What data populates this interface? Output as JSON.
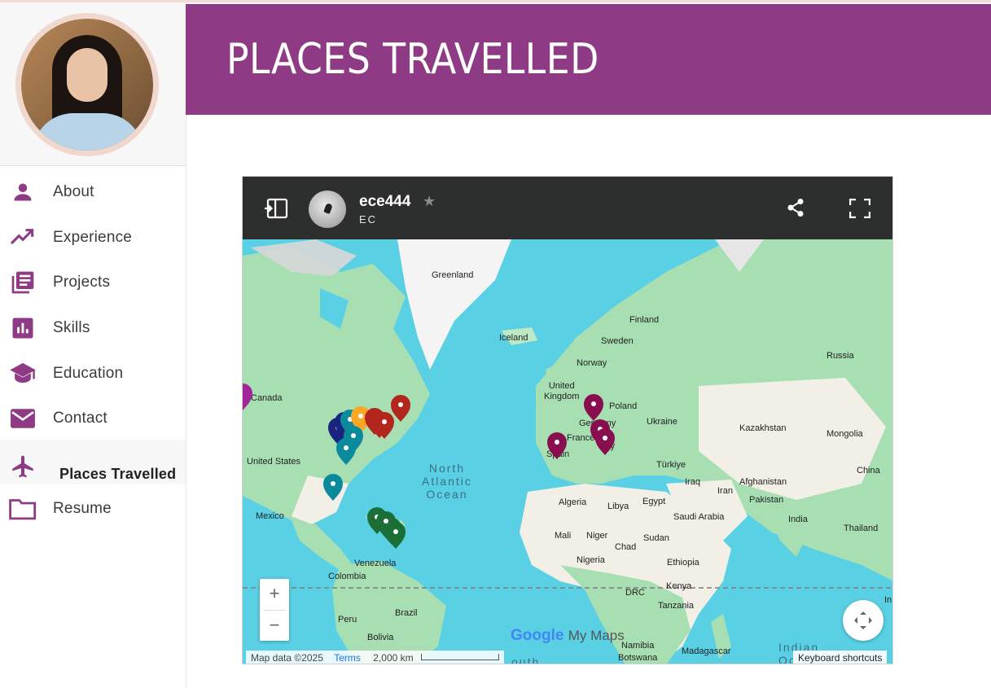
{
  "header": {
    "title": "PLACES TRAVELLED"
  },
  "sidebar": {
    "items": [
      {
        "label": "About",
        "icon": "person-icon"
      },
      {
        "label": "Experience",
        "icon": "trending-up-icon"
      },
      {
        "label": "Projects",
        "icon": "library-books-icon"
      },
      {
        "label": "Skills",
        "icon": "bar-chart-icon"
      },
      {
        "label": "Education",
        "icon": "graduation-cap-icon"
      },
      {
        "label": "Contact",
        "icon": "mail-icon"
      },
      {
        "label": "Places Travelled",
        "icon": "airplane-icon",
        "active": true
      },
      {
        "label": "Resume",
        "icon": "folder-icon"
      }
    ]
  },
  "embed": {
    "map_title": "ece444",
    "map_subtitle": "EC",
    "labels": {
      "greenland": "Greenland",
      "iceland": "Iceland",
      "finland": "Finland",
      "sweden": "Sweden",
      "norway": "Norway",
      "russia": "Russia",
      "uk": "United\nKingdom",
      "poland": "Poland",
      "germany": "Germany",
      "ukraine": "Ukraine",
      "kazakhstan": "Kazakhstan",
      "mongolia": "Mongolia",
      "france": "France",
      "italy": "Italy",
      "spain": "Spain",
      "turkiye": "Türkiye",
      "china": "China",
      "canada": "Canada",
      "us": "United States",
      "iraq": "Iraq",
      "iran": "Iran",
      "afghanistan": "Afghanistan",
      "pakistan": "Pakistan",
      "algeria": "Algeria",
      "libya": "Libya",
      "egypt": "Egypt",
      "saudi": "Saudi Arabia",
      "india": "India",
      "mexico": "Mexico",
      "mali": "Mali",
      "niger": "Niger",
      "chad": "Chad",
      "sudan": "Sudan",
      "thailand": "Thailand",
      "nigeria": "Nigeria",
      "ethiopia": "Ethiopia",
      "venezuela": "Venezuela",
      "colombia": "Colombia",
      "drc": "DRC",
      "kenya": "Kenya",
      "tanzania": "Tanzania",
      "brazil": "Brazil",
      "peru": "Peru",
      "bolivia": "Bolivia",
      "namibia": "Namibia",
      "botswana": "Botswana",
      "madagascar": "Madagascar",
      "indonesia": "In",
      "north_atlantic": "North\nAtlantic\nOcean",
      "indian_ocean": "Indian\nOc",
      "south": "outh"
    },
    "zoom_in": "+",
    "zoom_out": "−",
    "brand_google": "Google",
    "brand_mymaps": "My Maps",
    "map_data": "Map data ©2025",
    "terms": "Terms",
    "scale": "2,000 km",
    "keyboard": "Keyboard shortcuts",
    "pin_colors": {
      "purple": "#a4249a",
      "navy": "#1a237e",
      "yellow": "#f9a825",
      "red": "#b3261e",
      "teal": "#0b8a9c",
      "green": "#1b6e35",
      "wine": "#880e4f"
    }
  },
  "colors": {
    "accent": "#8e3a84",
    "map_bar": "#2d2e2e",
    "water": "#5ad0e4",
    "land": "#a8dfb2"
  }
}
